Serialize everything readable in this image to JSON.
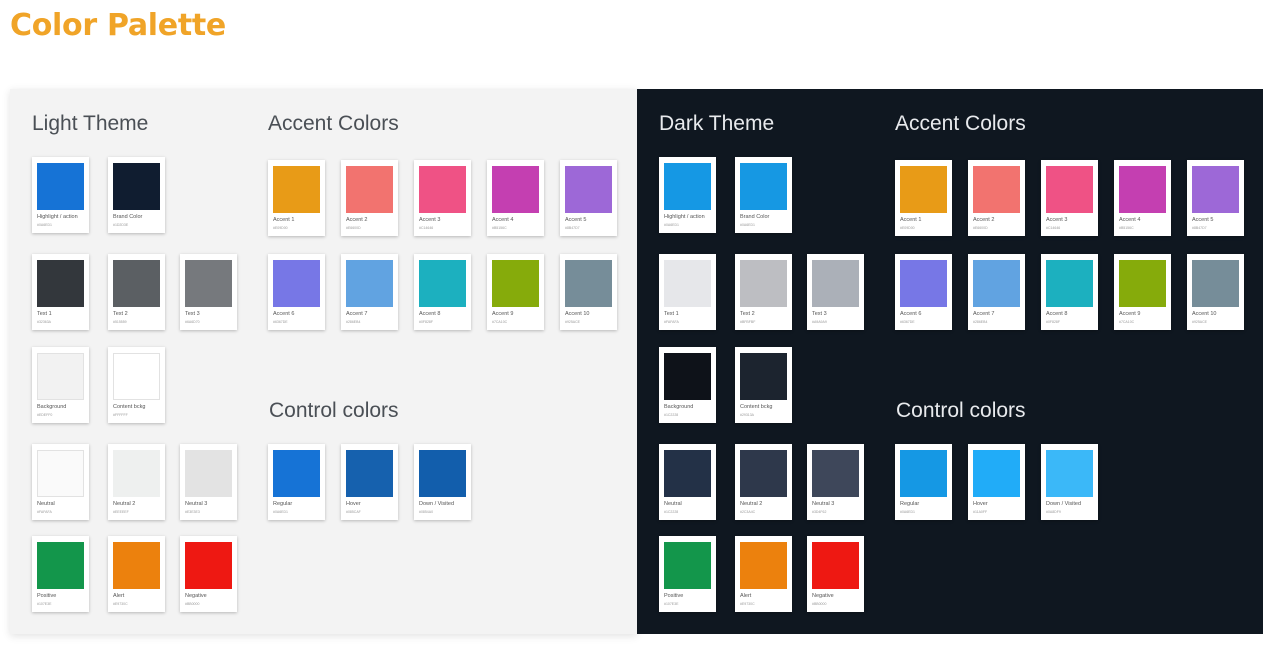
{
  "title": "Color Palette",
  "colors": {
    "title": "#f0a428",
    "light_panel_bg": "#f3f3f3",
    "dark_panel_bg": "#0f1720"
  },
  "light": {
    "theme_heading": "Light Theme",
    "accent_heading": "Accent Colors",
    "control_heading": "Control colors",
    "theme_swatches": [
      {
        "name": "Highlight / action",
        "hex": "#0A6ED1",
        "color": "#1673d6"
      },
      {
        "name": "Brand Color",
        "hex": "#1D2D3E",
        "color": "#101d30"
      },
      {
        "name": "Text 1",
        "hex": "#32363A",
        "color": "#33373c"
      },
      {
        "name": "Text 2",
        "hex": "#515559",
        "color": "#5b5f63"
      },
      {
        "name": "Text 3",
        "hex": "#6A6D70",
        "color": "#76797d"
      },
      {
        "name": "Background",
        "hex": "#EDEFF0",
        "color": "#f2f2f2"
      },
      {
        "name": "Content bckg",
        "hex": "#FFFFFF",
        "color": "#ffffff"
      },
      {
        "name": "Neutral",
        "hex": "#FAFAFA",
        "color": "#fafafa"
      },
      {
        "name": "Neutral 2",
        "hex": "#EEEEEF",
        "color": "#eef0ef"
      },
      {
        "name": "Neutral 3",
        "hex": "#E3E3E3",
        "color": "#e3e3e3"
      },
      {
        "name": "Positive",
        "hex": "#107E3E",
        "color": "#13964b"
      },
      {
        "name": "Alert",
        "hex": "#E9730C",
        "color": "#ec810d"
      },
      {
        "name": "Negative",
        "hex": "#BB0000",
        "color": "#ee1812"
      }
    ],
    "accent_swatches": [
      {
        "name": "Accent 1",
        "hex": "#E09D00",
        "color": "#e89b17"
      },
      {
        "name": "Accent 2",
        "hex": "#E6600D",
        "color": "#f2736f"
      },
      {
        "name": "Accent 3",
        "hex": "#C14646",
        "color": "#ef5285"
      },
      {
        "name": "Accent 4",
        "hex": "#B5156C",
        "color": "#c43fb1"
      },
      {
        "name": "Accent 5",
        "hex": "#8B47D7",
        "color": "#9d68d7"
      },
      {
        "name": "Accent 6",
        "hex": "#6367DE",
        "color": "#7777e6"
      },
      {
        "name": "Accent 7",
        "hex": "#286EB4",
        "color": "#61a3e1"
      },
      {
        "name": "Accent 8",
        "hex": "#0F828F",
        "color": "#1cb0bf"
      },
      {
        "name": "Accent 9",
        "hex": "#7CA10C",
        "color": "#86ab0b"
      },
      {
        "name": "Accent 10",
        "hex": "#925ACE",
        "color": "#768d99"
      }
    ],
    "control_swatches": [
      {
        "name": "Regular",
        "hex": "#0A6ED1",
        "color": "#1673d6"
      },
      {
        "name": "Hover",
        "hex": "#085CAF",
        "color": "#1661ae"
      },
      {
        "name": "Down / Visited",
        "hex": "#0854A0",
        "color": "#125eac"
      }
    ]
  },
  "dark": {
    "theme_heading": "Dark Theme",
    "accent_heading": "Accent Colors",
    "control_heading": "Control colors",
    "theme_swatches": [
      {
        "name": "Highlight / action",
        "hex": "#0A6ED1",
        "color": "#1598e4"
      },
      {
        "name": "Brand Color",
        "hex": "#0A6ED1",
        "color": "#1698e3"
      },
      {
        "name": "Text 1",
        "hex": "#FAFAFA",
        "color": "#e6e7ea"
      },
      {
        "name": "Text 2",
        "hex": "#BFBFBF",
        "color": "#bdbec2"
      },
      {
        "name": "Text 3",
        "hex": "#A9A9A9",
        "color": "#abb0b8"
      },
      {
        "name": "Background",
        "hex": "#1C2228",
        "color": "#0e1219"
      },
      {
        "name": "Content bckg",
        "hex": "#29313A",
        "color": "#1c242f"
      },
      {
        "name": "Neutral",
        "hex": "#1C2228",
        "color": "#233147"
      },
      {
        "name": "Neutral 2",
        "hex": "#2C3A4C",
        "color": "#2e384b"
      },
      {
        "name": "Neutral 3",
        "hex": "#3D4F62",
        "color": "#3e475a"
      },
      {
        "name": "Positive",
        "hex": "#107E3E",
        "color": "#13964b"
      },
      {
        "name": "Alert",
        "hex": "#E9730C",
        "color": "#ec810d"
      },
      {
        "name": "Negative",
        "hex": "#BB0000",
        "color": "#ee1812"
      }
    ],
    "accent_swatches": [
      {
        "name": "Accent 1",
        "hex": "#E09D00",
        "color": "#e89b17"
      },
      {
        "name": "Accent 2",
        "hex": "#E6600D",
        "color": "#f2736f"
      },
      {
        "name": "Accent 3",
        "hex": "#C14646",
        "color": "#ef5285"
      },
      {
        "name": "Accent 4",
        "hex": "#B5156C",
        "color": "#c43fb1"
      },
      {
        "name": "Accent 5",
        "hex": "#8B47D7",
        "color": "#9d68d7"
      },
      {
        "name": "Accent 6",
        "hex": "#6367DE",
        "color": "#7777e6"
      },
      {
        "name": "Accent 7",
        "hex": "#286EB4",
        "color": "#61a3e1"
      },
      {
        "name": "Accent 8",
        "hex": "#0F828F",
        "color": "#1cb0bf"
      },
      {
        "name": "Accent 9",
        "hex": "#7CA10C",
        "color": "#86ab0b"
      },
      {
        "name": "Accent 10",
        "hex": "#925ACE",
        "color": "#768d99"
      }
    ],
    "control_swatches": [
      {
        "name": "Regular",
        "hex": "#0A6ED1",
        "color": "#1598e4"
      },
      {
        "name": "Hover",
        "hex": "#11A0FF",
        "color": "#21acf8"
      },
      {
        "name": "Down / Visited",
        "hex": "#0A8DF9",
        "color": "#3bb8f8"
      }
    ]
  }
}
